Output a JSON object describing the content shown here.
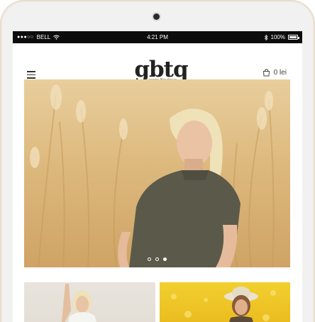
{
  "status_bar": {
    "signal_dots": "●●●○○",
    "carrier": "BELL",
    "time": "4:21 PM",
    "battery": "100%"
  },
  "header": {
    "logo_text": "gbtq",
    "logo_subtitle": "Garage Boutique",
    "cart_total": "0 lei"
  },
  "hero": {
    "slide_count": 3,
    "active_slide": 3
  },
  "colors": {
    "status_bar_bg": "#0c0c0c",
    "hero_tone": "#ddb97e",
    "tile_yellow": "#f2cf2f"
  },
  "icons": [
    "wifi-icon",
    "bluetooth-icon",
    "battery-icon",
    "hamburger-menu-icon",
    "shopping-bag-icon"
  ]
}
